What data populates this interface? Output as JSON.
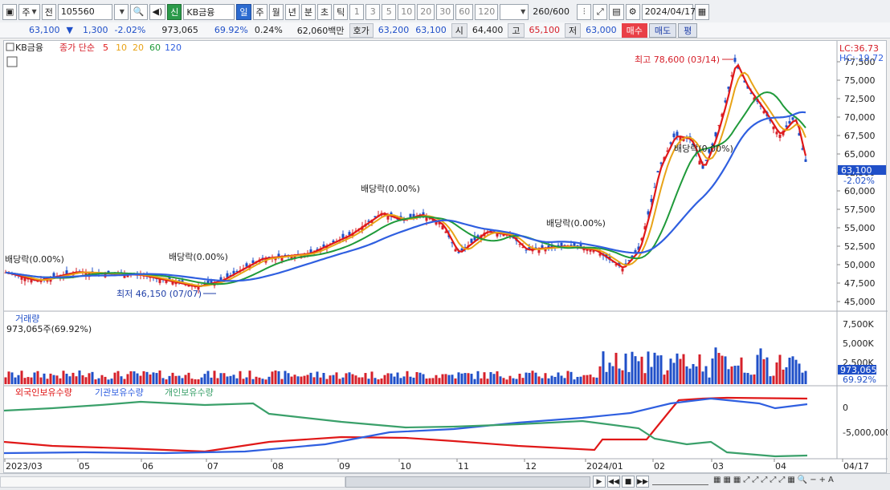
{
  "toolbar": {
    "period_unit": "주",
    "prev_label": "전",
    "stock_code": "105560",
    "market_badge": "신",
    "stock_name": "KB금융",
    "intervals": [
      "일",
      "주",
      "월",
      "년",
      "분",
      "초",
      "틱"
    ],
    "active_interval": "일",
    "minutes": [
      "1",
      "3",
      "5",
      "10",
      "20",
      "30",
      "60",
      "120"
    ],
    "count": "260",
    "count_max": "/600",
    "date": "2024/04/17",
    "icons": [
      "window-icon",
      "search-icon",
      "speaker-icon",
      "candlestick-icon",
      "crosshair-icon",
      "save-icon",
      "gear-icon"
    ]
  },
  "quote": {
    "price": "63,100",
    "direction": "▼",
    "change": "1,300",
    "change_pct": "-2.02%",
    "volume": "973,065",
    "volume_ratio": "69.92%",
    "turnover": "0.24%",
    "amount": "62,060백만",
    "ask_label": "호가",
    "ask1": "63,200",
    "ask2": "63,100",
    "open_label": "시",
    "open": "64,400",
    "high_label": "고",
    "high": "65,100",
    "low_label": "저",
    "low": "63,000",
    "buy_label": "매수",
    "sell_label": "매도",
    "eval_label": "평"
  },
  "colors": {
    "up": "#d6202a",
    "down": "#1f4fc8",
    "ma5": "#e01818",
    "ma10": "#e8a317",
    "ma20": "#e8a317",
    "ma60": "#1f9a3a",
    "ma120": "#2f5fe0",
    "foreign": "#e01818",
    "institution": "#2f5fe0",
    "individual": "#3aa06a"
  },
  "price_panel": {
    "name": "KB금융",
    "legend": {
      "prefix": "종가 단순",
      "ma5": "5",
      "ma10": "10",
      "ma20": "20",
      "ma60": "60",
      "ma120": "120"
    },
    "lc": "LC:36.73",
    "hc": "HC:-19.72",
    "current_price": "63,100",
    "current_pct": "-2.02%",
    "y_ticks": [
      "77,500",
      "75,000",
      "72,500",
      "70,000",
      "67,500",
      "65,000",
      "62,500",
      "60,000",
      "57,500",
      "55,000",
      "52,500",
      "50,000",
      "47,500",
      "45,000"
    ],
    "annotations": {
      "high": "최고 78,600 (03/14)",
      "low": "최저 46,150 (07/07)",
      "div1": "배당락(0.00%)",
      "div2": "배당락(0.00%)",
      "div3": "배당락(0.00%)",
      "div4": "배당락(0.00%)",
      "div5": "배당락(0.00%)"
    }
  },
  "volume_panel": {
    "title": "거래량",
    "info": "973,065주(69.92%)",
    "y_ticks": [
      "7,500K",
      "5,000K",
      "2,500K"
    ],
    "current": "973,065",
    "current_pct": "69.92%"
  },
  "holdings_panel": {
    "legend": [
      "외국인보유수량",
      "기관보유수량",
      "개인보유수량"
    ],
    "y_ticks": [
      "0",
      "-5,000,000"
    ]
  },
  "x_axis": [
    "2023/03",
    "05",
    "06",
    "07",
    "08",
    "09",
    "10",
    "11",
    "12",
    "2024/01",
    "02",
    "03",
    "04",
    "04/17"
  ],
  "bottom": {
    "controls": [
      "▶",
      "◀◀",
      "■",
      "▶▶"
    ]
  }
}
